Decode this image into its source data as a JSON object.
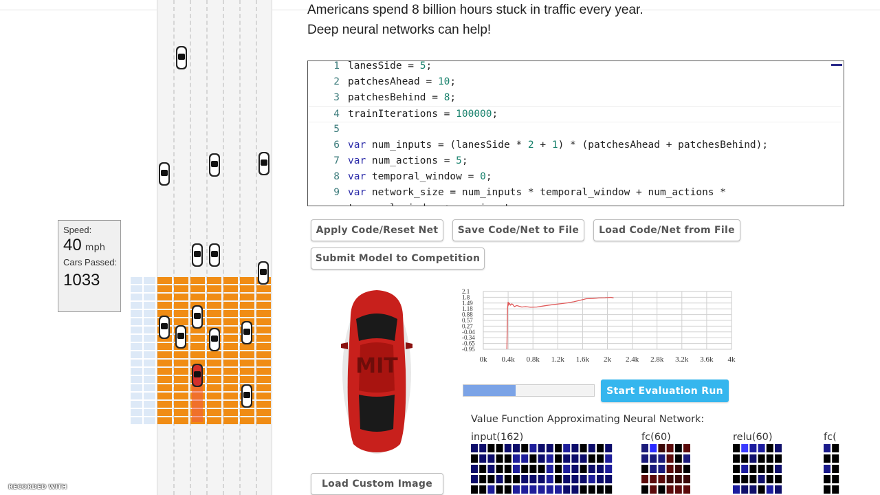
{
  "intro": {
    "line1": "Americans spend 8 billion hours stuck in traffic every year.",
    "line2": "Deep neural networks can help!"
  },
  "stats": {
    "speed_label": "Speed:",
    "speed_value": "40",
    "speed_unit": "mph",
    "cars_label": "Cars Passed:",
    "cars_value": "1033"
  },
  "code": [
    {
      "n": "1",
      "t": "lanesSide = 5;"
    },
    {
      "n": "2",
      "t": "patchesAhead = 10;"
    },
    {
      "n": "3",
      "t": "patchesBehind = 8;"
    },
    {
      "n": "4",
      "t": "trainIterations = 100000;"
    },
    {
      "n": "5",
      "t": ""
    },
    {
      "n": "6",
      "t": "var num_inputs = (lanesSide * 2 + 1) * (patchesAhead + patchesBehind);"
    },
    {
      "n": "7",
      "t": "var num_actions = 5;"
    },
    {
      "n": "8",
      "t": "var temporal_window = 0;"
    },
    {
      "n": "9",
      "t": "var network_size = num_inputs * temporal_window + num_actions *"
    },
    {
      "n": "",
      "t": "temporal_window + num_inputs;"
    }
  ],
  "buttons": {
    "apply": "Apply Code/Reset Net",
    "save": "Save Code/Net to File",
    "load": "Load Code/Net from File",
    "submit": "Submit Model to Competition",
    "start_eval": "Start Evaluation Run",
    "load_image": "Load Custom Image"
  },
  "progress": 0.4,
  "nn": {
    "title": "Value Function Approximating Neural Network:",
    "layers": [
      "input(162)",
      "fc(60)",
      "relu(60)",
      "fc("
    ]
  },
  "chart_data": {
    "type": "line",
    "xlim": [
      0,
      4000
    ],
    "ylim": [
      -0.95,
      2.1
    ],
    "xticks": [
      "0k",
      "0.4k",
      "0.8k",
      "1.2k",
      "1.6k",
      "2k",
      "2.4k",
      "2.8k",
      "3.2k",
      "3.6k",
      "4k"
    ],
    "yticks": [
      "2.1",
      "1.8",
      "1.49",
      "1.18",
      "0.88",
      "0.57",
      "0.27",
      "-0.04",
      "-0.34",
      "-0.65",
      "-0.95"
    ],
    "series": [
      {
        "color": "#e05a5a",
        "x": [
          380,
          390,
          400,
          410,
          420,
          440,
          460,
          480,
          500,
          540,
          580,
          620,
          680,
          760,
          860,
          960,
          1060,
          1160,
          1260,
          1360,
          1460,
          1560,
          1660,
          1760,
          1860,
          1960,
          2060,
          2100
        ],
        "y": [
          -0.95,
          1.2,
          1.55,
          1.4,
          1.48,
          1.38,
          1.45,
          1.4,
          1.3,
          1.36,
          1.32,
          1.28,
          1.3,
          1.27,
          1.28,
          1.33,
          1.38,
          1.42,
          1.46,
          1.5,
          1.56,
          1.64,
          1.72,
          1.73,
          1.76,
          1.77,
          1.79,
          1.76
        ]
      }
    ]
  },
  "watermark": "RECORDED WITH",
  "colors": {
    "accent": "#35b6ee",
    "grid_orange": "#f08c14",
    "car_white": "#ffffff",
    "agent_red": "#d2302c"
  }
}
